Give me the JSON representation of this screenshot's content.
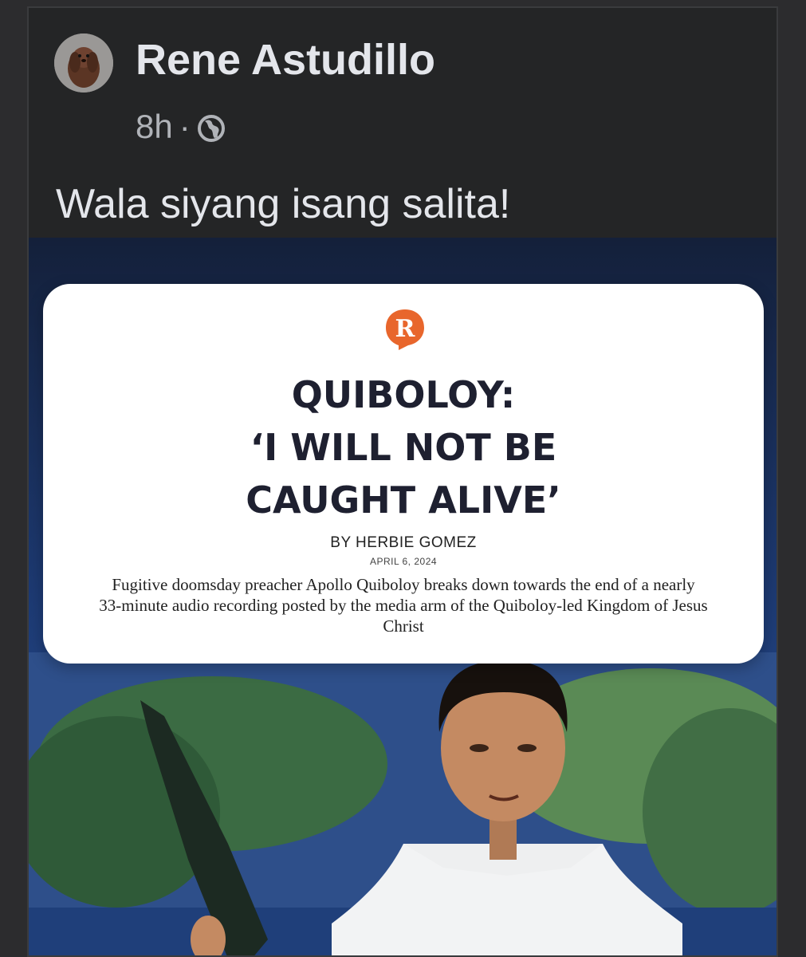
{
  "post": {
    "author": "Rene Astudillo",
    "time": "8h",
    "separator": "·",
    "audience_icon": "globe-icon",
    "caption": "Wala siyang isang salita!"
  },
  "article": {
    "logo_icon": "rappler-logo-icon",
    "logo_text": "R",
    "headline_line1": "QUIBOLOY:",
    "headline_line2": "‘I WILL NOT BE",
    "headline_line3": "CAUGHT ALIVE’",
    "byline": "BY HERBIE GOMEZ",
    "date": "APRIL 6, 2024",
    "summary": "Fugitive doomsday preacher Apollo Quiboloy breaks down towards the end of a nearly 33-minute audio recording posted by the media arm of the Quiboloy-led Kingdom of Jesus Christ"
  },
  "colors": {
    "background": "#242526",
    "text_primary": "#e4e6eb",
    "text_secondary": "#b0b3b8",
    "logo_accent": "#e8662c"
  }
}
